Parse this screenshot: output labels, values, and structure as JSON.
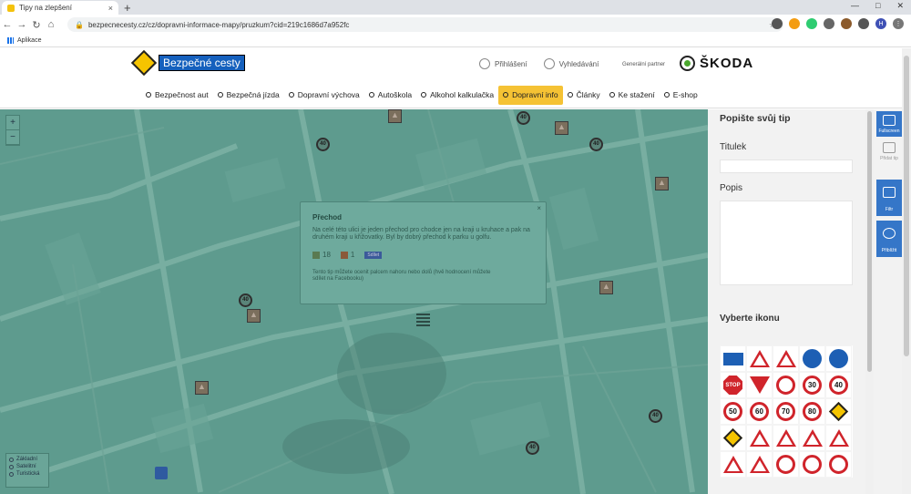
{
  "browser": {
    "tab_title": "Tipy na zlepšení",
    "tab_close": "×",
    "new_tab": "+",
    "url": "bezpecnecesty.cz/cz/dopravni-informace-mapy/pruzkum?cid=219c1686d7a952fc",
    "bookmarks_label": "Aplikace",
    "window_controls": [
      "—",
      "□",
      "✕"
    ]
  },
  "header": {
    "logo_text": "Bezpečné cesty",
    "login_label": "Přihlášení",
    "search_label": "Vyhledávání",
    "partner_label": "Generální partner",
    "partner_brand": "ŠKODA"
  },
  "nav": {
    "items": [
      {
        "label": "Bezpečnost aut"
      },
      {
        "label": "Bezpečná jízda"
      },
      {
        "label": "Dopravní výchova"
      },
      {
        "label": "Autoškola"
      },
      {
        "label": "Alkohol kalkulačka"
      },
      {
        "label": "Dopravní info",
        "active": true
      },
      {
        "label": "Články"
      },
      {
        "label": "Ke stažení"
      },
      {
        "label": "E-shop"
      }
    ]
  },
  "map": {
    "zoom_in": "+",
    "zoom_out": "−",
    "map_types": [
      "Základní",
      "Satelitní",
      "Turistická"
    ],
    "speed_sign_text": "40",
    "popup": {
      "close": "×",
      "title": "Přechod",
      "description": "Na celé této ulici je jeden přechod pro chodce jen na kraji u kruhace a pak na druhém kraji u křižovatky. Byl by dobrý přechod k parku u golfu.",
      "likes": "18",
      "dislikes": "1",
      "share_label": "Sdílet",
      "note": "Tento tip můžete ocenit palcem nahoru nebo dolů (hvě hodnocení můžete sdílet na Facebooku)"
    }
  },
  "panel": {
    "title": "Popište svůj tip",
    "title_label": "Titulek",
    "description_label": "Popis",
    "icons_label": "Vyberte ikonu",
    "speed_values": [
      "30",
      "40",
      "50",
      "60",
      "70",
      "80"
    ],
    "stop_text": "STOP"
  },
  "tools": [
    {
      "label": "Fullscreen"
    },
    {
      "label": "Přidat tip"
    },
    {
      "label": "Filtr"
    },
    {
      "label": "Přiblížit"
    }
  ],
  "colors": {
    "nav_active": "#f5c234",
    "map_overlay": "#5e9b8e",
    "tool_blue": "#3576c8",
    "sign_red": "#d0242b"
  }
}
